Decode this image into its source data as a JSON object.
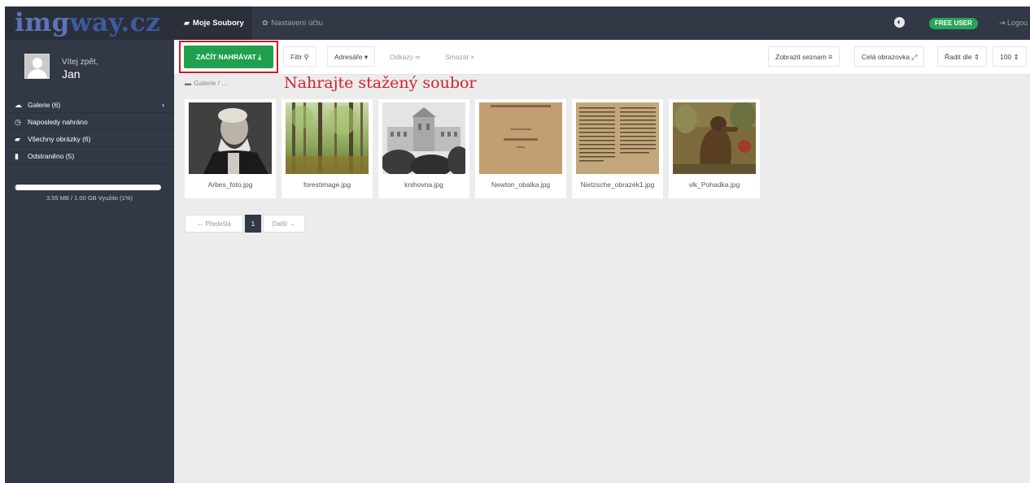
{
  "logo": {
    "part1": "img",
    "part2": "way.cz"
  },
  "tabs": {
    "files": "Moje Soubory",
    "settings": "Nastavení účtu"
  },
  "header": {
    "badge": "FREE USER",
    "logout": "Logou"
  },
  "user": {
    "welcome": "Vítej zpět,",
    "name": "Jan"
  },
  "sidebar": {
    "items": [
      {
        "icon": "cloud-icon",
        "label": "Galerie (6)"
      },
      {
        "icon": "clock-icon",
        "label": "Naposledy nahráno"
      },
      {
        "icon": "images-icon",
        "label": "Všechny obrázky (6)"
      },
      {
        "icon": "trash-icon",
        "label": "Odstraněno (5)"
      }
    ],
    "usage_fraction": 0.01,
    "usage_text": "3.55 MB / 1.00 GB Využito (1%)"
  },
  "toolbar": {
    "upload": "ZAČÍT NAHRÁVAT",
    "filter": "Filtr",
    "dirs": "Adresáře",
    "links": "Odkazy",
    "delete": "Smazat",
    "list": "Zobrazit seznam",
    "fullscreen": "Celá obrazovka",
    "sort": "Řadit dle",
    "count": "100"
  },
  "breadcrumb": {
    "root": "Galerie",
    "rest": "/ ..."
  },
  "annotation": "Nahrajte stažený soubor",
  "files": [
    {
      "name": "Arbes_foto.jpg"
    },
    {
      "name": "forestimage.jpg"
    },
    {
      "name": "knihovna.jpg"
    },
    {
      "name": "Newton_obalka.jpg"
    },
    {
      "name": "Nietzsche_obrazek1.jpg"
    },
    {
      "name": "vlk_Pohadka.jpg"
    }
  ],
  "pagination": {
    "prev": "← Předešlá",
    "current": "1",
    "next": "Další →"
  },
  "colors": {
    "topbar": "#323845",
    "accent_green": "#20a04f",
    "highlight_red": "#d01b1b",
    "annotation_red": "#d3202a"
  }
}
